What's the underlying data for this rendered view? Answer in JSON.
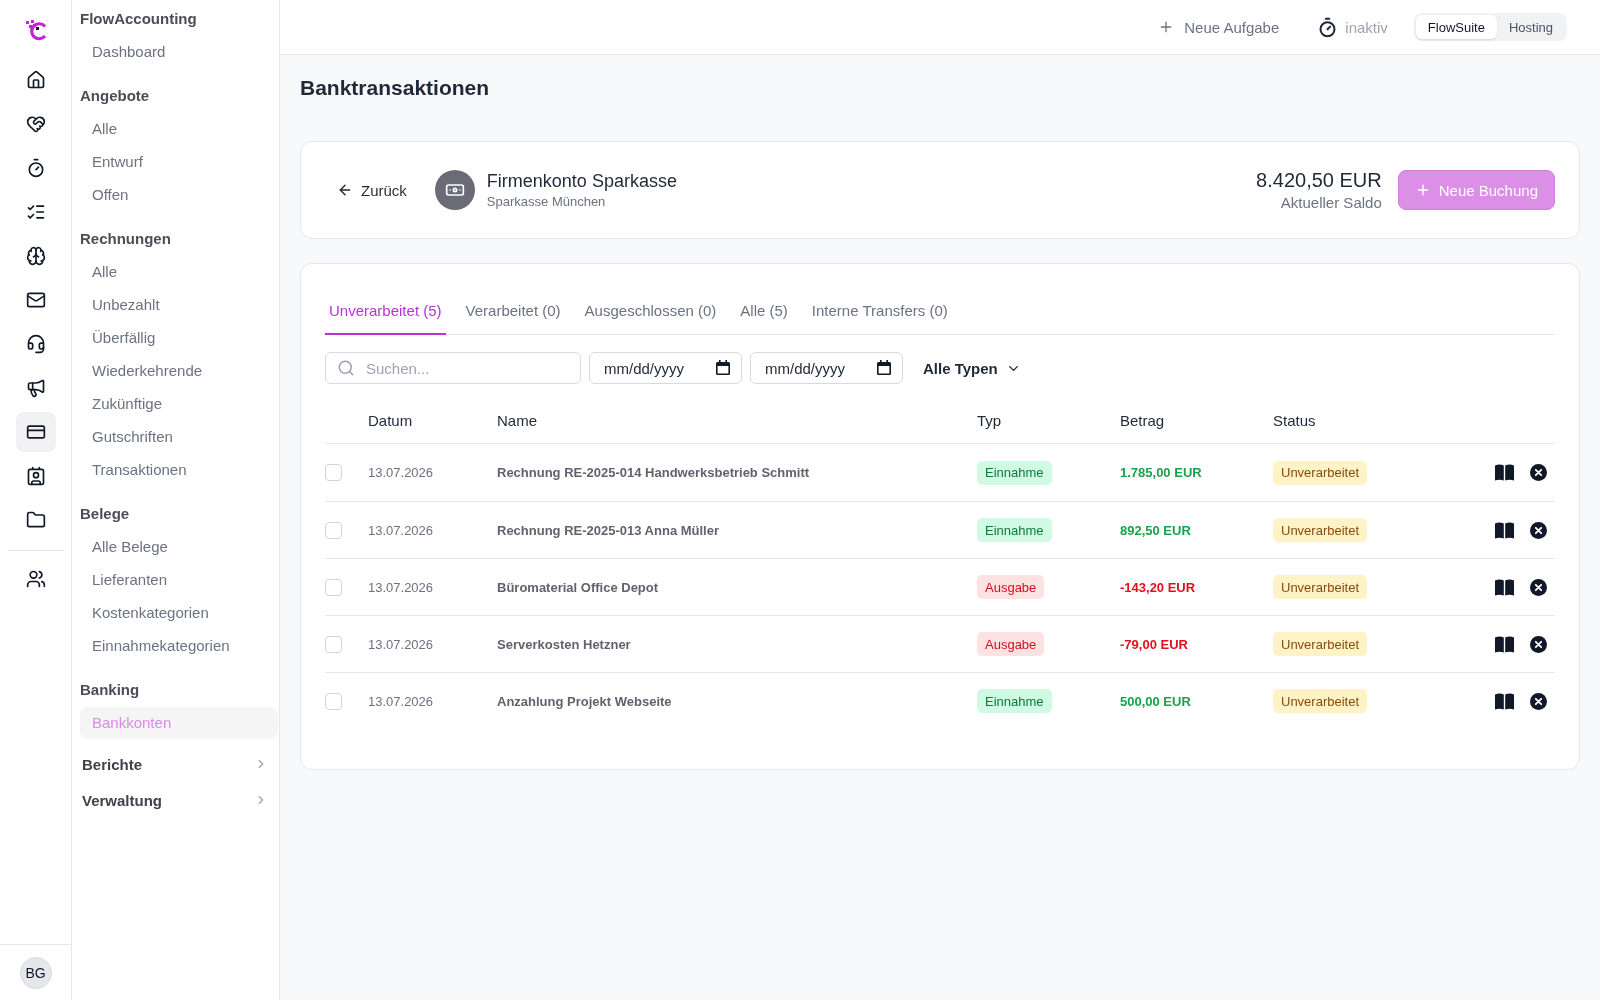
{
  "icon_rail": {
    "items": [
      {
        "selected": false
      },
      {
        "selected": false
      },
      {
        "selected": false
      },
      {
        "selected": false
      },
      {
        "selected": false
      },
      {
        "selected": false
      },
      {
        "selected": false
      },
      {
        "selected": false
      },
      {
        "selected": true
      },
      {
        "selected": false
      },
      {
        "selected": false
      }
    ],
    "extra_items": [
      {
        "selected": false
      }
    ],
    "avatar": {
      "initials": "BG"
    }
  },
  "sidebar": {
    "sections": [
      {
        "title": "FlowAccounting",
        "items": [
          {
            "label": "Dashboard",
            "selected": false
          }
        ]
      },
      {
        "title": "Angebote",
        "items": [
          {
            "label": "Alle",
            "selected": false
          },
          {
            "label": "Entwurf",
            "selected": false
          },
          {
            "label": "Offen",
            "selected": false
          }
        ]
      },
      {
        "title": "Rechnungen",
        "items": [
          {
            "label": "Alle",
            "selected": false
          },
          {
            "label": "Unbezahlt",
            "selected": false
          },
          {
            "label": "Überfällig",
            "selected": false
          },
          {
            "label": "Wiederkehrende",
            "selected": false
          },
          {
            "label": "Zukünftige",
            "selected": false
          },
          {
            "label": "Gutschriften",
            "selected": false
          },
          {
            "label": "Transaktionen",
            "selected": false
          }
        ]
      },
      {
        "title": "Belege",
        "items": [
          {
            "label": "Alle Belege",
            "selected": false
          },
          {
            "label": "Lieferanten",
            "selected": false
          },
          {
            "label": "Kostenkategorien",
            "selected": false
          },
          {
            "label": "Einnahmekategorien",
            "selected": false
          }
        ]
      },
      {
        "title": "Banking",
        "items": [
          {
            "label": "Bankkonten",
            "selected": true
          }
        ]
      }
    ],
    "groups": [
      {
        "label": "Berichte",
        "expanded": false
      },
      {
        "label": "Verwaltung",
        "expanded": false
      }
    ]
  },
  "top_bar": {
    "new_task": {
      "label": "Neue Aufgabe"
    },
    "timer": {
      "label": "inaktiv"
    },
    "workspaces": [
      {
        "label": "FlowSuite",
        "selected": true
      },
      {
        "label": "Hosting",
        "selected": false
      }
    ]
  },
  "page": {
    "title": "Banktransaktionen"
  },
  "account_card": {
    "back_button": {
      "label": "Zurück"
    },
    "name": "Firmenkonto Sparkasse",
    "bank": "Sparkasse München",
    "balance": "8.420,50 EUR",
    "balance_label": "Aktueller Saldo",
    "new_booking_button": {
      "label": "Neue Buchung"
    }
  },
  "transactions": {
    "tabs": [
      {
        "label": "Unverarbeitet (5)",
        "selected": true
      },
      {
        "label": "Verarbeitet (0)",
        "selected": false
      },
      {
        "label": "Ausgeschlossen (0)",
        "selected": false
      },
      {
        "label": "Alle (5)",
        "selected": false
      },
      {
        "label": "Interne Transfers (0)",
        "selected": false
      }
    ],
    "search": {
      "placeholder": "Suchen..."
    },
    "date_from": {
      "placeholder": "mm/dd/yyyy"
    },
    "date_to": {
      "placeholder": "mm/dd/yyyy"
    },
    "type_filter": {
      "value": "Alle Typen"
    },
    "table": {
      "columns": [
        "Datum",
        "Name",
        "Typ",
        "Betrag",
        "Status"
      ],
      "rows": [
        {
          "checked": false,
          "date": "13.07.2026",
          "name": "Rechnung RE-2025-014 Handwerksbetrieb Schmitt",
          "type": {
            "label": "Einnahme",
            "kind": "income"
          },
          "amount": "1.785,00 EUR",
          "status": {
            "label": "Unverarbeitet",
            "kind": "pending"
          }
        },
        {
          "checked": false,
          "date": "13.07.2026",
          "name": "Rechnung RE-2025-013 Anna Müller",
          "type": {
            "label": "Einnahme",
            "kind": "income"
          },
          "amount": "892,50 EUR",
          "status": {
            "label": "Unverarbeitet",
            "kind": "pending"
          }
        },
        {
          "checked": false,
          "date": "13.07.2026",
          "name": "Büromaterial Office Depot",
          "type": {
            "label": "Ausgabe",
            "kind": "expense"
          },
          "amount": "-143,20 EUR",
          "status": {
            "label": "Unverarbeitet",
            "kind": "pending"
          }
        },
        {
          "checked": false,
          "date": "13.07.2026",
          "name": "Serverkosten Hetzner",
          "type": {
            "label": "Ausgabe",
            "kind": "expense"
          },
          "amount": "-79,00 EUR",
          "status": {
            "label": "Unverarbeitet",
            "kind": "pending"
          }
        },
        {
          "checked": false,
          "date": "13.07.2026",
          "name": "Anzahlung Projekt Webseite",
          "type": {
            "label": "Einnahme",
            "kind": "income"
          },
          "amount": "500,00 EUR",
          "status": {
            "label": "Unverarbeitet",
            "kind": "pending"
          }
        }
      ]
    }
  }
}
